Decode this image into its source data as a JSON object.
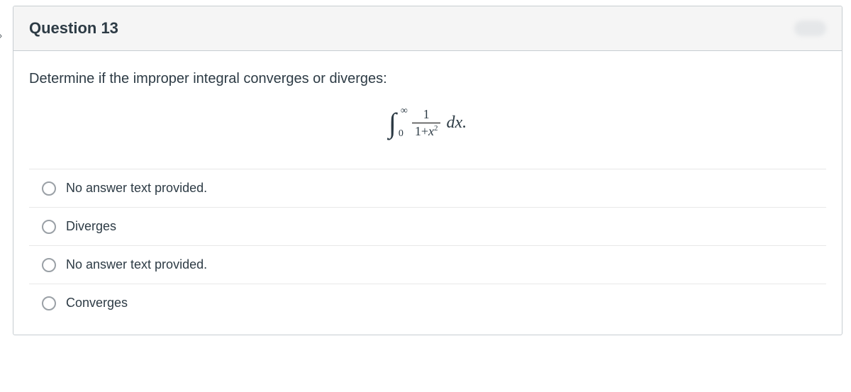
{
  "header": {
    "title": "Question 13"
  },
  "prompt": "Determine if the improper integral converges or diverges:",
  "integral": {
    "lower": "0",
    "upper": "∞",
    "numerator": "1",
    "denominator_prefix": "1+",
    "denominator_var": "x",
    "denominator_exp": "2",
    "dx": "dx.",
    "symbol": "∫"
  },
  "answers": [
    {
      "label": "No answer text provided."
    },
    {
      "label": "Diverges"
    },
    {
      "label": "No answer text provided."
    },
    {
      "label": "Converges"
    }
  ]
}
